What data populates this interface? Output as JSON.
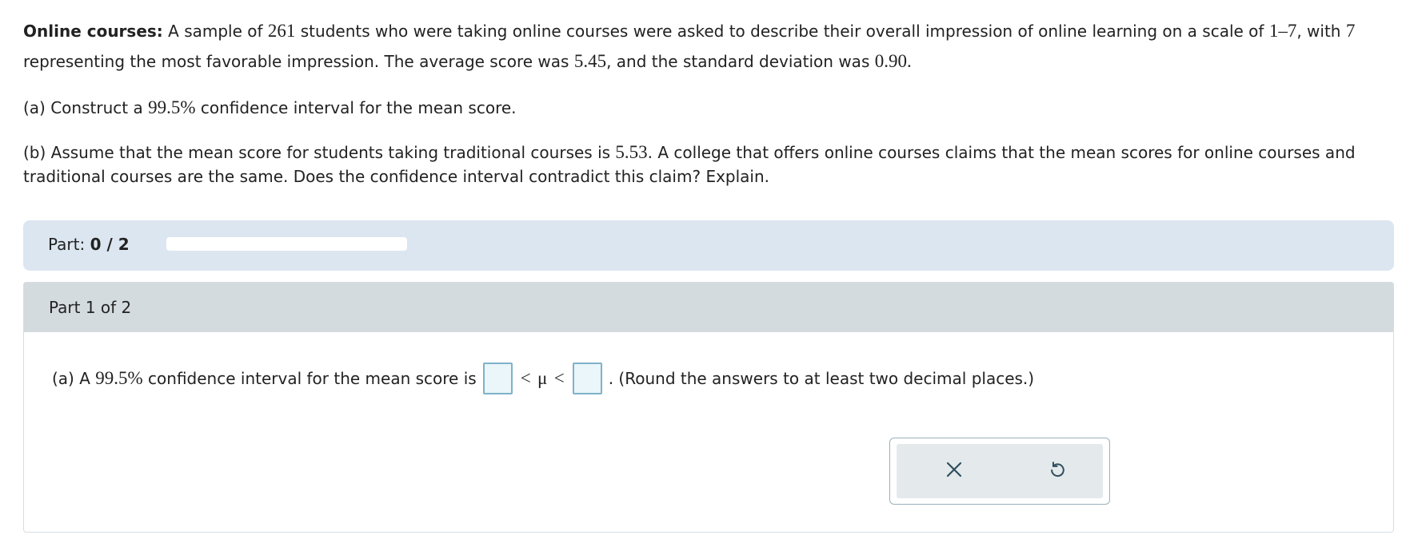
{
  "problem": {
    "lead": "Online courses:",
    "intro_1": "A sample of",
    "n": "261",
    "intro_2": "students who were taking online courses were asked to describe their overall impression of online learning on a scale of",
    "scale": "1–7",
    "intro_3": ", with",
    "seven": "7",
    "intro_4": "representing the most favorable impression. The average score was",
    "mean": "5.45",
    "intro_5": ", and the standard deviation was",
    "sd": "0.90",
    "intro_6": ".",
    "a_1": "(a) Construct a",
    "a_pct": "99.5%",
    "a_2": "confidence interval for the mean score.",
    "b_1": "(b) Assume that the mean score for students taking traditional courses is",
    "b_val": "5.53",
    "b_2": ". A college that offers online courses claims that the mean scores for online courses and traditional courses are the same. Does the confidence interval contradict this claim? Explain."
  },
  "progress": {
    "label": "Part:",
    "value": "0 / 2",
    "fraction": 0.0
  },
  "part": {
    "header": "Part 1 of 2",
    "q_1": "(a) A",
    "q_pct": "99.5%",
    "q_2": "confidence interval for the mean score is",
    "lt_1": "<",
    "mu": "μ",
    "lt_2": "<",
    "q_3": ". (Round the answers to at least two decimal places.)",
    "lower_value": "",
    "upper_value": ""
  },
  "tools": {
    "clear_icon": "x-icon",
    "undo_icon": "undo-icon"
  },
  "colors": {
    "progress_bg": "#dce6f0",
    "part_header_bg": "#d4dbdf",
    "answer_border": "#7fb2c9",
    "answer_fill": "#eaf6f9"
  }
}
